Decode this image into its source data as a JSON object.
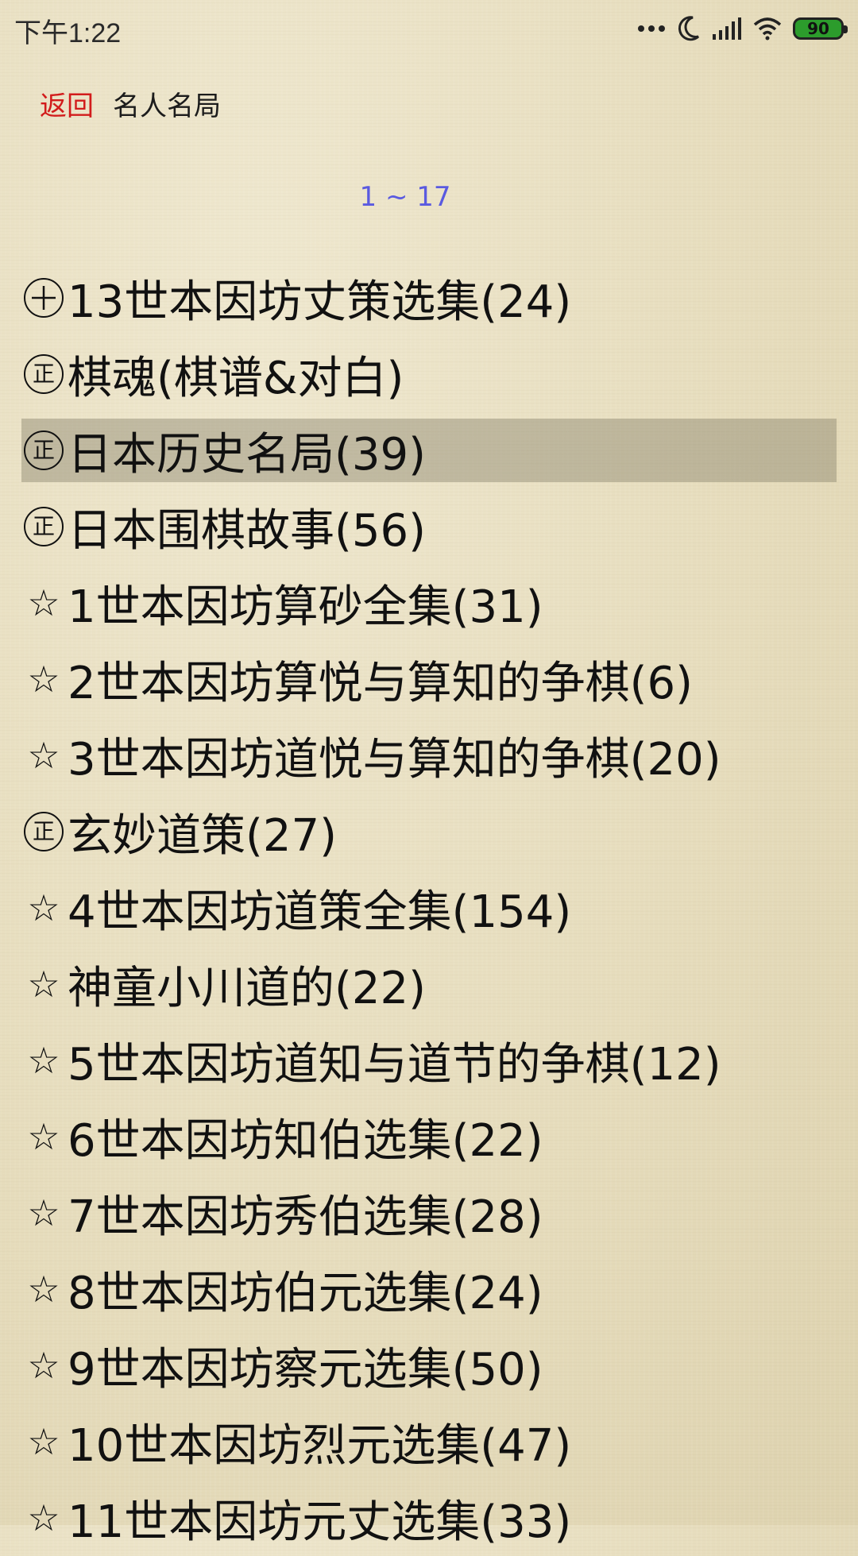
{
  "status_bar": {
    "time": "下午1:22",
    "battery_level": "90",
    "icons": [
      "more-dots-icon",
      "moon-icon",
      "signal-icon",
      "wifi-icon",
      "battery-icon"
    ]
  },
  "header": {
    "back_label": "返回",
    "title": "名人名局"
  },
  "range_label": "1 ~ 17",
  "colors": {
    "back": "#d21c1c",
    "range": "#5a5ae0",
    "background": "#e8dfc2"
  },
  "items": [
    {
      "icon": "⊕",
      "icon_type": "circle-plus",
      "label": "13世本因坊丈策选集(24)",
      "selected": false
    },
    {
      "icon": "正",
      "icon_type": "circle-zheng",
      "label": "棋魂(棋谱&对白)",
      "selected": false
    },
    {
      "icon": "正",
      "icon_type": "circle-zheng",
      "label": "日本历史名局(39)",
      "selected": true
    },
    {
      "icon": "正",
      "icon_type": "circle-zheng",
      "label": "日本围棋故事(56)",
      "selected": false
    },
    {
      "icon": "☆",
      "icon_type": "star",
      "label": "1世本因坊算砂全集(31)",
      "selected": false
    },
    {
      "icon": "☆",
      "icon_type": "star",
      "label": "2世本因坊算悦与算知的争棋(6)",
      "selected": false
    },
    {
      "icon": "☆",
      "icon_type": "star",
      "label": "3世本因坊道悦与算知的争棋(20)",
      "selected": false
    },
    {
      "icon": "正",
      "icon_type": "circle-zheng",
      "label": "玄妙道策(27)",
      "selected": false
    },
    {
      "icon": "☆",
      "icon_type": "star",
      "label": "4世本因坊道策全集(154)",
      "selected": false
    },
    {
      "icon": "☆",
      "icon_type": "star",
      "label": "神童小川道的(22)",
      "selected": false
    },
    {
      "icon": "☆",
      "icon_type": "star",
      "label": "5世本因坊道知与道节的争棋(12)",
      "selected": false
    },
    {
      "icon": "☆",
      "icon_type": "star",
      "label": "6世本因坊知伯选集(22)",
      "selected": false
    },
    {
      "icon": "☆",
      "icon_type": "star",
      "label": "7世本因坊秀伯选集(28)",
      "selected": false
    },
    {
      "icon": "☆",
      "icon_type": "star",
      "label": "8世本因坊伯元选集(24)",
      "selected": false
    },
    {
      "icon": "☆",
      "icon_type": "star",
      "label": "9世本因坊察元选集(50)",
      "selected": false
    },
    {
      "icon": "☆",
      "icon_type": "star",
      "label": "10世本因坊烈元选集(47)",
      "selected": false
    },
    {
      "icon": "☆",
      "icon_type": "star",
      "label": "11世本因坊元丈选集(33)",
      "selected": false
    }
  ]
}
